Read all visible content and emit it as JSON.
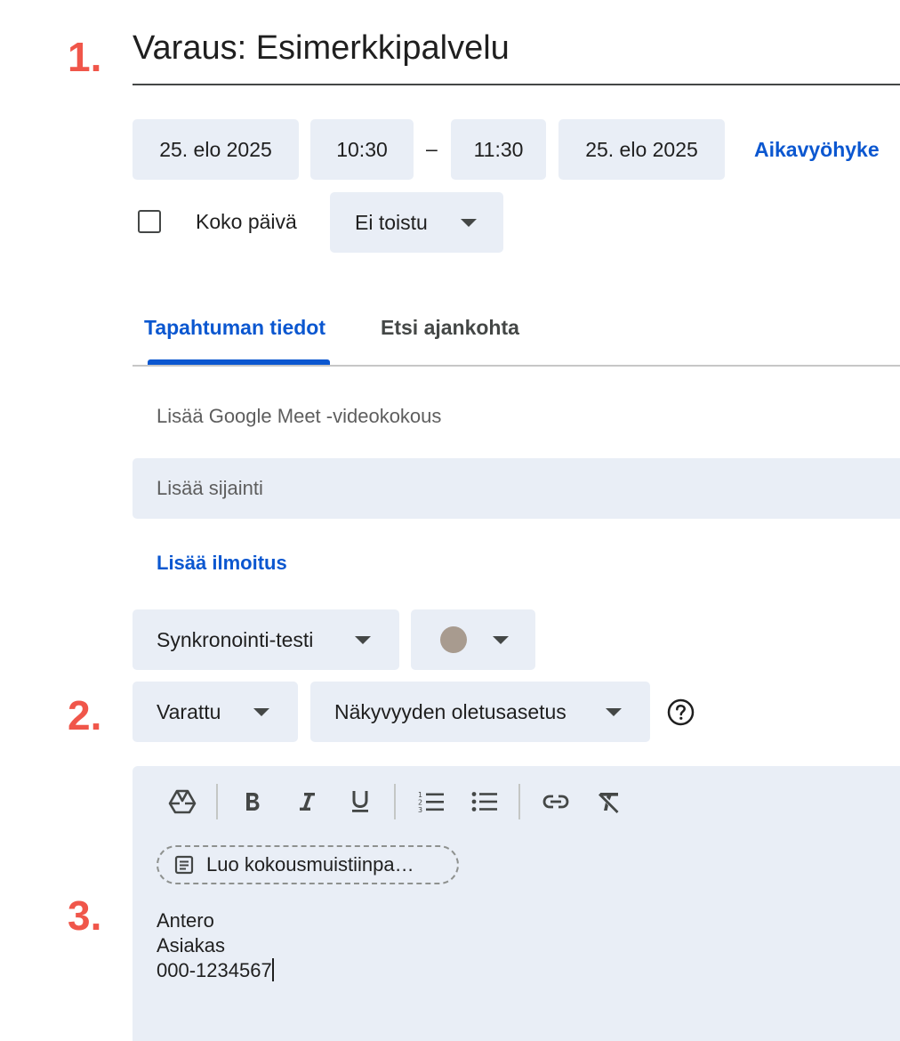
{
  "annotations": {
    "step1": "1.",
    "step2": "2.",
    "step3": "3."
  },
  "event": {
    "title": "Varaus: Esimerkkipalvelu"
  },
  "datetime": {
    "start_date": "25. elo 2025",
    "start_time": "10:30",
    "separator": "–",
    "end_time": "11:30",
    "end_date": "25. elo 2025",
    "timezone_link": "Aikavyöhyke",
    "all_day_label": "Koko päivä",
    "all_day_checked": false,
    "recurrence": "Ei toistu"
  },
  "tabs": {
    "event_details": "Tapahtuman tiedot",
    "find_time": "Etsi ajankohta"
  },
  "details": {
    "meet": "Lisää Google Meet -videokokous",
    "location_placeholder": "Lisää sijainti",
    "notification_link": "Lisää ilmoitus",
    "calendar": "Synkronointi-testi",
    "event_color": "#a89b8f",
    "availability": "Varattu",
    "visibility": "Näkyvyyden oletusasetus"
  },
  "toolbar": {
    "icons": [
      "drive-icon",
      "bold-icon",
      "italic-icon",
      "underline-icon",
      "numbered-list-icon",
      "bulleted-list-icon",
      "link-icon",
      "clear-formatting-icon"
    ]
  },
  "description": {
    "notes_chip": "Luo kokousmuistiinpa…",
    "lines": [
      "Antero",
      "Asiakas",
      "000-1234567"
    ]
  },
  "colors": {
    "accent": "#0b57d0",
    "annotation": "#f0564a",
    "chip_background": "#e9eef6"
  }
}
